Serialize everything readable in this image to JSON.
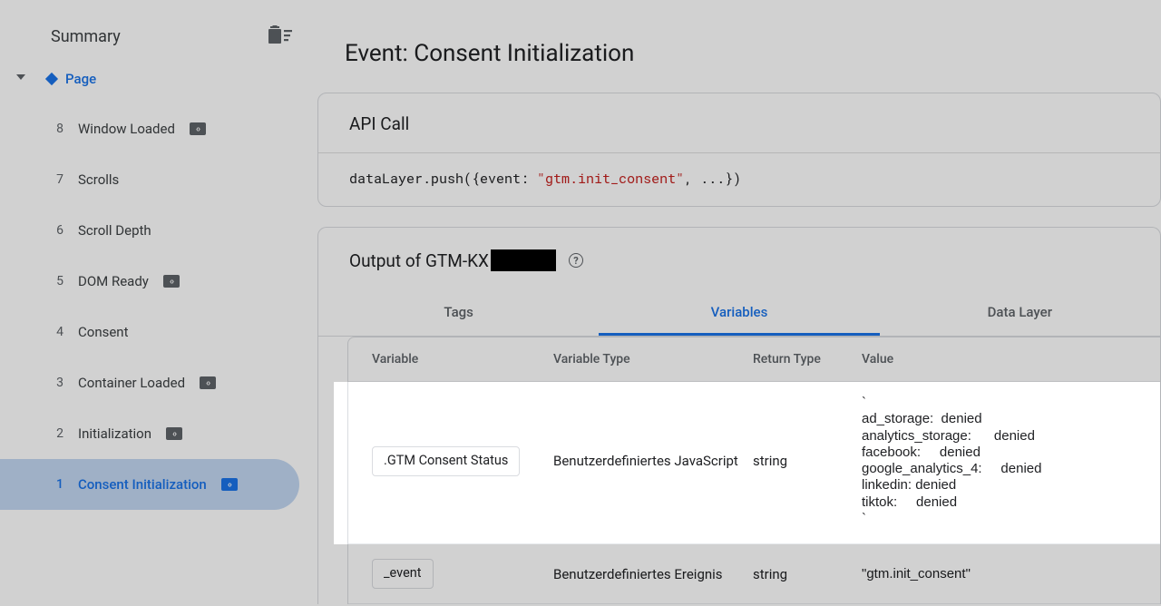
{
  "sidebar": {
    "title": "Summary",
    "root_label": "Page",
    "events": [
      {
        "index": "8",
        "label": "Window Loaded",
        "badge": true,
        "active": false
      },
      {
        "index": "7",
        "label": "Scrolls",
        "badge": false,
        "active": false
      },
      {
        "index": "6",
        "label": "Scroll Depth",
        "badge": false,
        "active": false
      },
      {
        "index": "5",
        "label": "DOM Ready",
        "badge": true,
        "active": false
      },
      {
        "index": "4",
        "label": "Consent",
        "badge": false,
        "active": false
      },
      {
        "index": "3",
        "label": "Container Loaded",
        "badge": true,
        "active": false
      },
      {
        "index": "2",
        "label": "Initialization",
        "badge": true,
        "active": false
      },
      {
        "index": "1",
        "label": "Consent Initialization",
        "badge": true,
        "active": true
      }
    ]
  },
  "main": {
    "event_title_prefix": "Event: ",
    "event_title": "Consent Initialization",
    "api_call": {
      "heading": "API Call",
      "code_prefix": "dataLayer.push({event: ",
      "code_string": "\"gtm.init_consent\"",
      "code_suffix": ", ...})"
    },
    "output": {
      "heading_prefix": "Output of GTM-KX",
      "tabs": [
        "Tags",
        "Variables",
        "Data Layer"
      ],
      "active_tab_index": 1,
      "table": {
        "headers": [
          "Variable",
          "Variable Type",
          "Return Type",
          "Value"
        ],
        "rows": [
          {
            "name": ".GTM Consent Status",
            "type": "Benutzerdefiniertes JavaScript",
            "return_type": "string",
            "value": "`\nad_storage:  denied\nanalytics_storage:      denied\nfacebook:     denied\ngoogle_analytics_4:     denied\nlinkedin: denied\ntiktok:     denied\n`",
            "highlight": true
          },
          {
            "name": "_event",
            "type": "Benutzerdefiniertes Ereignis",
            "return_type": "string",
            "value": "gtm.init_consent",
            "quoted": true
          }
        ]
      }
    }
  }
}
